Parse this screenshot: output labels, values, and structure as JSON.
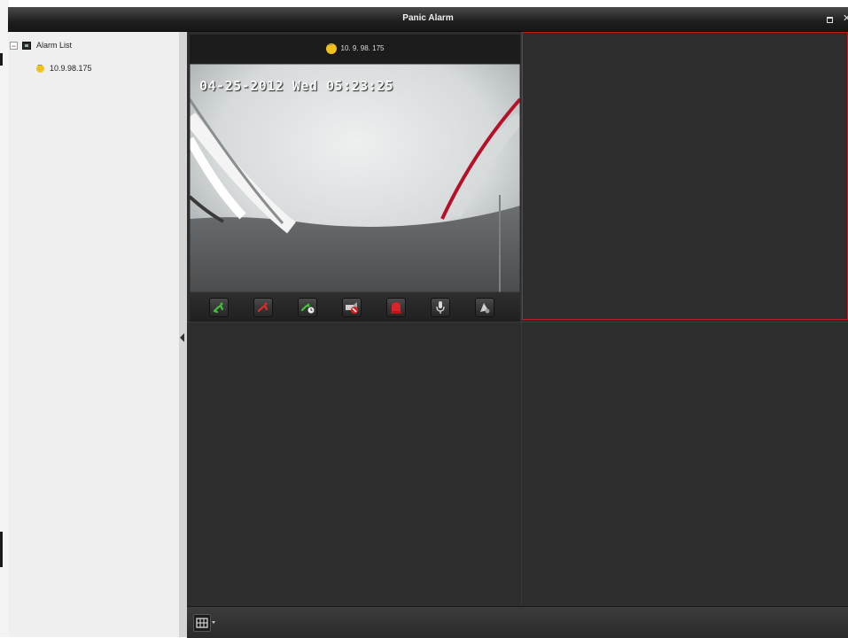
{
  "window": {
    "title": "Panic Alarm"
  },
  "sidebar": {
    "root": {
      "label": "Alarm List"
    },
    "items": [
      {
        "label": "10.9.98.175"
      }
    ]
  },
  "video_cell": {
    "device_ip": "10. 9. 98. 175",
    "osd_timestamp": "04-25-2012 Wed 05:23:25"
  },
  "icons": {
    "controls": [
      "answer-call-icon",
      "hang-up-icon",
      "call-timer-icon",
      "mute-icon",
      "alarm-off-icon",
      "microphone-icon",
      "speaker-icon"
    ],
    "layout": "grid-layout-icon"
  },
  "colors": {
    "selected_cell_border": "#c11d1d",
    "status_dot": "#f2c21b"
  }
}
